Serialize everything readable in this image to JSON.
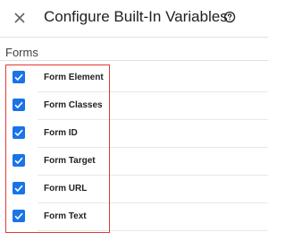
{
  "header": {
    "title": "Configure Built-In Variables",
    "close_icon": "close-icon",
    "help_icon": "help-circle-icon"
  },
  "section": {
    "title": "Forms"
  },
  "variables": [
    {
      "label": "Form Element",
      "checked": true
    },
    {
      "label": "Form Classes",
      "checked": true
    },
    {
      "label": "Form ID",
      "checked": true
    },
    {
      "label": "Form Target",
      "checked": true
    },
    {
      "label": "Form URL",
      "checked": true
    },
    {
      "label": "Form Text",
      "checked": true
    }
  ],
  "colors": {
    "checkbox": "#1a73e8",
    "highlight_border": "#e53935"
  }
}
